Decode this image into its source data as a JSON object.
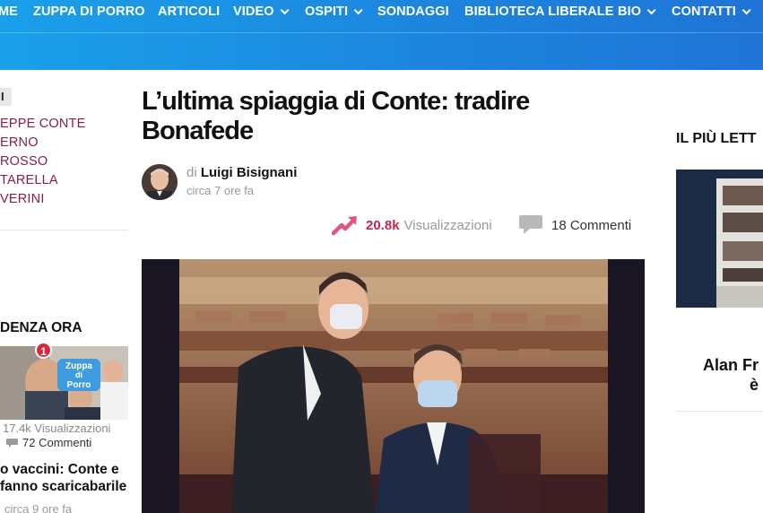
{
  "nav": {
    "items": [
      {
        "label": "ME",
        "dropdown": false
      },
      {
        "label": "ZUPPA DI PORRO",
        "dropdown": false
      },
      {
        "label": "ARTICOLI",
        "dropdown": false
      },
      {
        "label": "VIDEO",
        "dropdown": true
      },
      {
        "label": "OSPITI",
        "dropdown": true
      },
      {
        "label": "SONDAGGI",
        "dropdown": false
      },
      {
        "label": "BIBLIOTECA LIBERALE",
        "dropdown": false
      },
      {
        "label": "BIO",
        "dropdown": true
      },
      {
        "label": "CONTATTI",
        "dropdown": true
      }
    ]
  },
  "left_sidebar": {
    "tag_label": "I",
    "links": [
      "EPPE CONTE",
      "ERNO",
      "ROSSO",
      "TARELLA",
      "VERINI"
    ],
    "trending_title": "DENZA ORA",
    "trending": {
      "badge": "1",
      "image_caption": [
        "Zuppa",
        "di",
        "Porro"
      ],
      "views": "17.4k Visualizzazioni",
      "comments": "72 Commenti",
      "headline": "o vaccini: Conte e fanno scaricabarile",
      "time": "circa 9 ore fa"
    }
  },
  "article": {
    "title": "L’ultima spiaggia di Conte: tradire Bonafede",
    "author_prefix": "di",
    "author": "Luigi Bisignani",
    "time": "circa 7 ore fa",
    "views_count": "20.8k",
    "views_label": "Visualizzazioni",
    "comments": "18 Commenti"
  },
  "right_sidebar": {
    "title": "IL PIÙ LETT",
    "headline_line1": "Alan Fr",
    "headline_line2": "è"
  },
  "colors": {
    "nav_gradient_start": "#1aa0ea",
    "nav_gradient_end": "#1f74d6",
    "link_color": "#8a1f45",
    "accent_red": "#c42553",
    "badge_red": "#e0243a"
  },
  "icons": {
    "trending": "trending-up-arrow-icon",
    "comments": "speech-bubble-icon",
    "chevron": "chevron-down-icon"
  }
}
